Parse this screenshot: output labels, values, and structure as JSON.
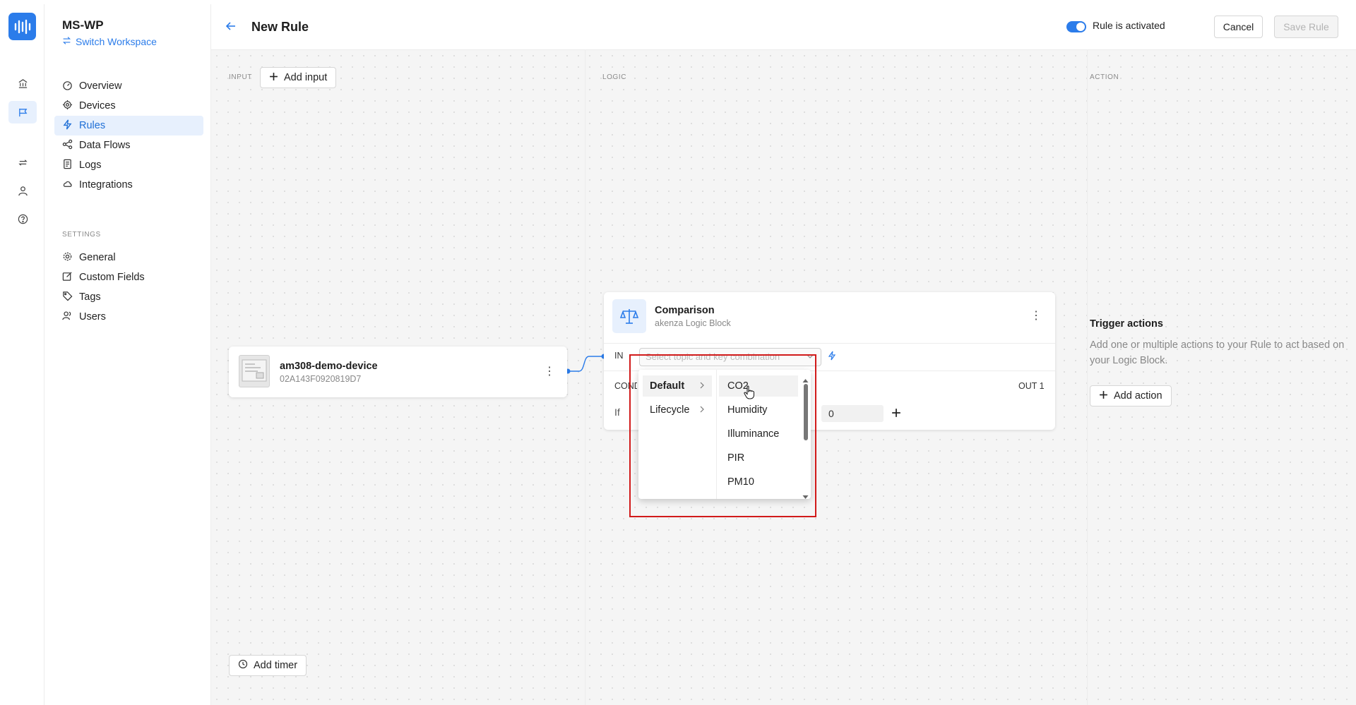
{
  "app": {
    "brand_color": "#2b7cea"
  },
  "rail": {
    "icons": [
      "logo-icon",
      "home-icon",
      "flag-icon",
      "repeat-icon",
      "user-icon",
      "help-icon"
    ]
  },
  "workspace": {
    "name": "MS-WP",
    "switch_label": "Switch Workspace"
  },
  "nav": {
    "items": [
      {
        "label": "Overview",
        "icon": "dashboard-icon"
      },
      {
        "label": "Devices",
        "icon": "device-icon"
      },
      {
        "label": "Rules",
        "icon": "bolt-icon",
        "active": true
      },
      {
        "label": "Data Flows",
        "icon": "share-icon"
      },
      {
        "label": "Logs",
        "icon": "log-icon"
      },
      {
        "label": "Integrations",
        "icon": "cloud-icon"
      }
    ],
    "settings_heading": "SETTINGS",
    "settings_items": [
      {
        "label": "General",
        "icon": "gear-icon"
      },
      {
        "label": "Custom Fields",
        "icon": "edit-icon"
      },
      {
        "label": "Tags",
        "icon": "tag-icon"
      },
      {
        "label": "Users",
        "icon": "users-icon"
      }
    ]
  },
  "header": {
    "title": "New Rule",
    "toggle_label": "Rule is activated",
    "toggle_on": true,
    "cancel_label": "Cancel",
    "save_label": "Save Rule"
  },
  "canvas": {
    "input_label": "INPUT",
    "add_input_label": "Add input",
    "logic_label": "LOGIC",
    "action_label": "ACTION",
    "add_timer_label": "Add timer"
  },
  "device": {
    "name": "am308-demo-device",
    "id": "02A143F0920819D7"
  },
  "logic_block": {
    "name": "Comparison",
    "subtitle": "akenza Logic Block",
    "in_label": "IN 1",
    "select_placeholder": "Select topic and key combination",
    "condition_label": "CONDITION",
    "out_label": "OUT 1",
    "if_label": "If",
    "compare_value": "0"
  },
  "dropdown": {
    "categories": [
      {
        "label": "Default",
        "selected": true
      },
      {
        "label": "Lifecycle",
        "selected": false
      }
    ],
    "options": [
      "CO2",
      "Humidity",
      "Illuminance",
      "PIR",
      "PM10"
    ],
    "hovered": "CO2"
  },
  "trigger": {
    "title": "Trigger actions",
    "description": "Add one or multiple actions to your Rule to act based on your Logic Block.",
    "add_action_label": "Add action"
  }
}
